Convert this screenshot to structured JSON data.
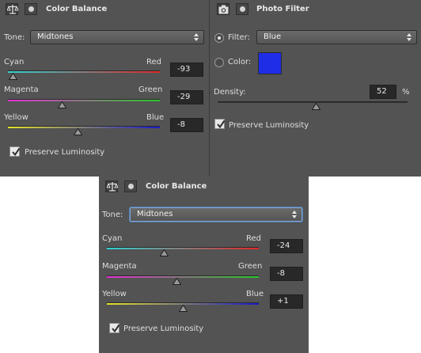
{
  "color_balance_1": {
    "title": "Color Balance",
    "tone_label": "Tone:",
    "tone_value": "Midtones",
    "sliders": [
      {
        "left": "Cyan",
        "right": "Red",
        "value": "-93",
        "level": -93
      },
      {
        "left": "Magenta",
        "right": "Green",
        "value": "-29",
        "level": -29
      },
      {
        "left": "Yellow",
        "right": "Blue",
        "value": "-8",
        "level": -8
      }
    ],
    "preserve_label": "Preserve Luminosity",
    "preserve_checked": true
  },
  "photo_filter": {
    "title": "Photo Filter",
    "filter_label": "Filter:",
    "filter_value": "Blue",
    "filter_selected": true,
    "color_label": "Color:",
    "color_swatch": "#1f2ee6",
    "density_label": "Density:",
    "density_value": "52",
    "density_unit": "%",
    "density_level": 52,
    "preserve_label": "Preserve Luminosity",
    "preserve_checked": true
  },
  "color_balance_2": {
    "title": "Color Balance",
    "tone_label": "Tone:",
    "tone_value": "Midtones",
    "sliders": [
      {
        "left": "Cyan",
        "right": "Red",
        "value": "-24",
        "level": -24
      },
      {
        "left": "Magenta",
        "right": "Green",
        "value": "-8",
        "level": -8
      },
      {
        "left": "Yellow",
        "right": "Blue",
        "value": "+1",
        "level": 1
      }
    ],
    "preserve_label": "Preserve Luminosity",
    "preserve_checked": true
  }
}
